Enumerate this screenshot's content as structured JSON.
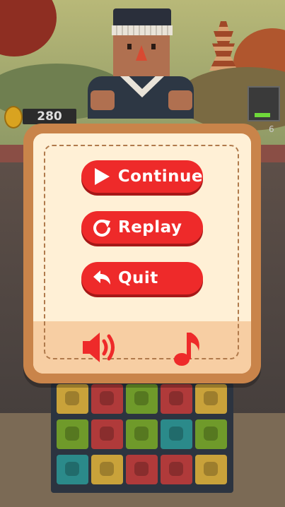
{
  "hud": {
    "score": "280",
    "tank_count": "6"
  },
  "pause_menu": {
    "continue_label": "Continue",
    "replay_label": "Replay",
    "quit_label": "Quit"
  },
  "colors": {
    "button_red": "#ee2a2a",
    "panel_cream": "#fff0d6",
    "frame_brown": "#c9844a",
    "tile_yellow": "#c9a23a",
    "tile_red": "#b03a3a",
    "tile_green": "#6f9a2a",
    "tile_teal": "#2b8a8a"
  },
  "board": {
    "rows": [
      [
        "yellow",
        "red",
        "green",
        "red",
        "yellow"
      ],
      [
        "green",
        "red",
        "green",
        "teal",
        "green"
      ],
      [
        "teal",
        "yellow",
        "red",
        "red",
        "yellow"
      ]
    ]
  },
  "icons": [
    "play-icon",
    "replay-icon",
    "back-arrow-icon",
    "sound-icon",
    "music-note-icon",
    "coin-icon"
  ]
}
